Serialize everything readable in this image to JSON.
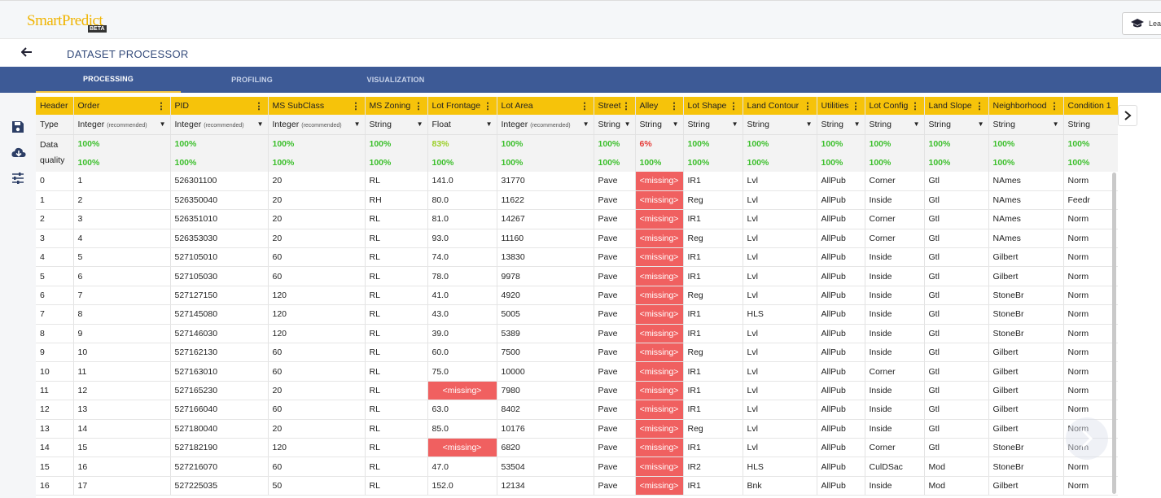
{
  "app": {
    "logo_main": "SmartPredict",
    "logo_badge": "BETA",
    "learn_label": "Lea"
  },
  "title": {
    "text": "DATASET PROCESSOR"
  },
  "tabs": [
    {
      "label": "PROCESSING",
      "active": true
    },
    {
      "label": "PROFILING",
      "active": false
    },
    {
      "label": "VISUALIZATION",
      "active": false
    }
  ],
  "icons": {
    "save": "save-icon",
    "download": "cloud-download-icon",
    "settings": "sliders-icon",
    "back": "arrow-left-icon",
    "expand": "chevron-right-icon",
    "next": "chevron-right-icon"
  },
  "colors": {
    "header_yellow": "#f6c30a",
    "tab_blue": "#3d5a96",
    "missing_red": "#f06060",
    "quality_green": "#3cbf2c",
    "quality_warn": "#9bcf27",
    "quality_bad": "#e53935"
  },
  "grid": {
    "row_header_label": "Header",
    "type_label": "Type",
    "quality_label": "Data quality",
    "recommended": "(recommended)",
    "missing": "<missing>",
    "columns": [
      {
        "name": "Order",
        "type": "Integer",
        "recommended": true,
        "q1": "100%",
        "q2": "100%"
      },
      {
        "name": "PID",
        "type": "Integer",
        "recommended": true,
        "q1": "100%",
        "q2": "100%"
      },
      {
        "name": "MS SubClass",
        "type": "Integer",
        "recommended": true,
        "q1": "100%",
        "q2": "100%"
      },
      {
        "name": "MS Zoning",
        "type": "String",
        "recommended": false,
        "q1": "100%",
        "q2": "100%"
      },
      {
        "name": "Lot Frontage",
        "type": "Float",
        "recommended": false,
        "q1": "83%",
        "q2": "100%"
      },
      {
        "name": "Lot Area",
        "type": "Integer",
        "recommended": true,
        "q1": "100%",
        "q2": "100%"
      },
      {
        "name": "Street",
        "type": "String",
        "recommended": false,
        "q1": "100%",
        "q2": "100%"
      },
      {
        "name": "Alley",
        "type": "String",
        "recommended": false,
        "q1": "6%",
        "q2": "100%"
      },
      {
        "name": "Lot Shape",
        "type": "String",
        "recommended": false,
        "q1": "100%",
        "q2": "100%"
      },
      {
        "name": "Land Contour",
        "type": "String",
        "recommended": false,
        "q1": "100%",
        "q2": "100%"
      },
      {
        "name": "Utilities",
        "type": "String",
        "recommended": false,
        "q1": "100%",
        "q2": "100%"
      },
      {
        "name": "Lot Config",
        "type": "String",
        "recommended": false,
        "q1": "100%",
        "q2": "100%"
      },
      {
        "name": "Land Slope",
        "type": "String",
        "recommended": false,
        "q1": "100%",
        "q2": "100%"
      },
      {
        "name": "Neighborhood",
        "type": "String",
        "recommended": false,
        "q1": "100%",
        "q2": "100%"
      },
      {
        "name": "Condition 1",
        "type": "String",
        "recommended": false,
        "q1": "100%",
        "q2": "100%"
      }
    ],
    "rows": [
      [
        "0",
        "1",
        "526301100",
        "20",
        "RL",
        "141.0",
        "31770",
        "Pave",
        null,
        "IR1",
        "Lvl",
        "AllPub",
        "Corner",
        "Gtl",
        "NAmes",
        "Norm"
      ],
      [
        "1",
        "2",
        "526350040",
        "20",
        "RH",
        "80.0",
        "11622",
        "Pave",
        null,
        "Reg",
        "Lvl",
        "AllPub",
        "Inside",
        "Gtl",
        "NAmes",
        "Feedr"
      ],
      [
        "2",
        "3",
        "526351010",
        "20",
        "RL",
        "81.0",
        "14267",
        "Pave",
        null,
        "IR1",
        "Lvl",
        "AllPub",
        "Corner",
        "Gtl",
        "NAmes",
        "Norm"
      ],
      [
        "3",
        "4",
        "526353030",
        "20",
        "RL",
        "93.0",
        "11160",
        "Pave",
        null,
        "Reg",
        "Lvl",
        "AllPub",
        "Corner",
        "Gtl",
        "NAmes",
        "Norm"
      ],
      [
        "4",
        "5",
        "527105010",
        "60",
        "RL",
        "74.0",
        "13830",
        "Pave",
        null,
        "IR1",
        "Lvl",
        "AllPub",
        "Inside",
        "Gtl",
        "Gilbert",
        "Norm"
      ],
      [
        "5",
        "6",
        "527105030",
        "60",
        "RL",
        "78.0",
        "9978",
        "Pave",
        null,
        "IR1",
        "Lvl",
        "AllPub",
        "Inside",
        "Gtl",
        "Gilbert",
        "Norm"
      ],
      [
        "6",
        "7",
        "527127150",
        "120",
        "RL",
        "41.0",
        "4920",
        "Pave",
        null,
        "Reg",
        "Lvl",
        "AllPub",
        "Inside",
        "Gtl",
        "StoneBr",
        "Norm"
      ],
      [
        "7",
        "8",
        "527145080",
        "120",
        "RL",
        "43.0",
        "5005",
        "Pave",
        null,
        "IR1",
        "HLS",
        "AllPub",
        "Inside",
        "Gtl",
        "StoneBr",
        "Norm"
      ],
      [
        "8",
        "9",
        "527146030",
        "120",
        "RL",
        "39.0",
        "5389",
        "Pave",
        null,
        "IR1",
        "Lvl",
        "AllPub",
        "Inside",
        "Gtl",
        "StoneBr",
        "Norm"
      ],
      [
        "9",
        "10",
        "527162130",
        "60",
        "RL",
        "60.0",
        "7500",
        "Pave",
        null,
        "Reg",
        "Lvl",
        "AllPub",
        "Inside",
        "Gtl",
        "Gilbert",
        "Norm"
      ],
      [
        "10",
        "11",
        "527163010",
        "60",
        "RL",
        "75.0",
        "10000",
        "Pave",
        null,
        "IR1",
        "Lvl",
        "AllPub",
        "Corner",
        "Gtl",
        "Gilbert",
        "Norm"
      ],
      [
        "11",
        "12",
        "527165230",
        "20",
        "RL",
        null,
        "7980",
        "Pave",
        null,
        "IR1",
        "Lvl",
        "AllPub",
        "Inside",
        "Gtl",
        "Gilbert",
        "Norm"
      ],
      [
        "12",
        "13",
        "527166040",
        "60",
        "RL",
        "63.0",
        "8402",
        "Pave",
        null,
        "IR1",
        "Lvl",
        "AllPub",
        "Inside",
        "Gtl",
        "Gilbert",
        "Norm"
      ],
      [
        "13",
        "14",
        "527180040",
        "20",
        "RL",
        "85.0",
        "10176",
        "Pave",
        null,
        "Reg",
        "Lvl",
        "AllPub",
        "Inside",
        "Gtl",
        "Gilbert",
        "Norm"
      ],
      [
        "14",
        "15",
        "527182190",
        "120",
        "RL",
        null,
        "6820",
        "Pave",
        null,
        "IR1",
        "Lvl",
        "AllPub",
        "Corner",
        "Gtl",
        "StoneBr",
        "Norm"
      ],
      [
        "15",
        "16",
        "527216070",
        "60",
        "RL",
        "47.0",
        "53504",
        "Pave",
        null,
        "IR2",
        "HLS",
        "AllPub",
        "CulDSac",
        "Mod",
        "StoneBr",
        "Norm"
      ],
      [
        "16",
        "17",
        "527225035",
        "50",
        "RL",
        "152.0",
        "12134",
        "Pave",
        null,
        "IR1",
        "Bnk",
        "AllPub",
        "Inside",
        "Mod",
        "Gilbert",
        "Norm"
      ]
    ]
  }
}
